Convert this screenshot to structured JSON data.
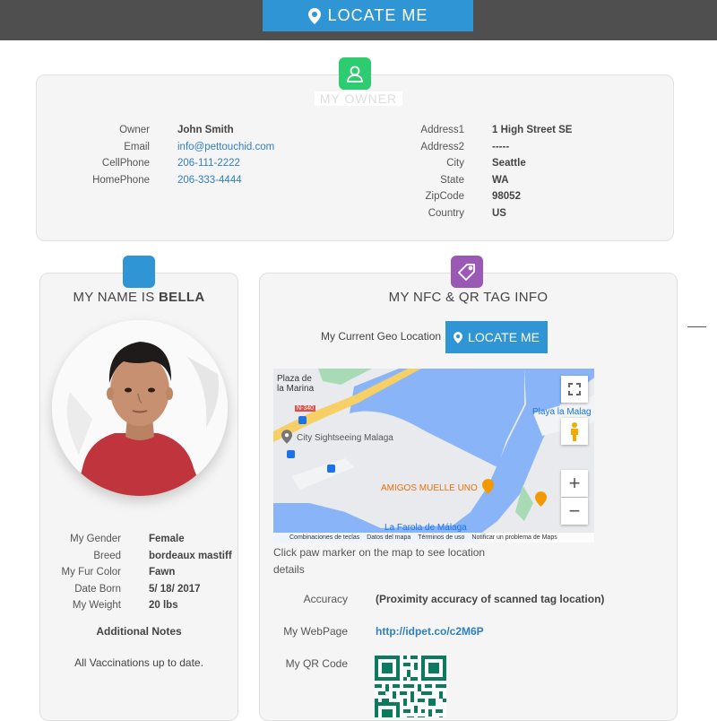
{
  "header": {
    "locate_label": "LOCATE ME"
  },
  "owner": {
    "title": "MY OWNER",
    "left_fields": [
      {
        "label": "Owner",
        "value": "John Smith"
      },
      {
        "label": "Email",
        "value": "info@pettouchid.com"
      },
      {
        "label": "CellPhone",
        "value": "206-111-2222"
      },
      {
        "label": "HomePhone",
        "value": "206-333-4444"
      }
    ],
    "right_fields": [
      {
        "label": "Address1",
        "value": "1 High Street SE"
      },
      {
        "label": "Address2",
        "value": "-----"
      },
      {
        "label": "City",
        "value": "Seattle"
      },
      {
        "label": "State",
        "value": "WA"
      },
      {
        "label": "ZipCode",
        "value": "98052"
      },
      {
        "label": "Country",
        "value": "US"
      }
    ]
  },
  "pet": {
    "title_prefix": "MY NAME IS",
    "name": "BELLA",
    "fields": [
      {
        "label": "My Gender",
        "value": "Female"
      },
      {
        "label": "Breed",
        "value": "bordeaux mastiff"
      },
      {
        "label": "My Fur Color",
        "value": "Fawn"
      },
      {
        "label": "Date Born",
        "value": "5/ 18/ 2017"
      },
      {
        "label": "My Weight",
        "value": "20 lbs"
      }
    ],
    "notes_title": "Additional Notes",
    "notes_text": "All Vaccinations up to date."
  },
  "nfc": {
    "title": "MY NFC & QR TAG INFO",
    "geo_label": "My Current Geo Location",
    "locate_label": "LOCATE ME",
    "map": {
      "labels": {
        "plaza": "Plaza de",
        "plaza2": "la Marina",
        "road": "N-340",
        "sightseeing": "City Sightseeing Malaga",
        "playa": "Playa la Malag",
        "amigos": "AMIGOS MUELLE UNO",
        "farola": "La Farola de Málaga"
      },
      "footer": [
        "Combinaciones de teclas",
        "Datos del mapa",
        "Términos de uso",
        "Notificar un problema de Maps"
      ]
    },
    "hint": "Click paw marker on the map to see location details",
    "accuracy_label": "Accuracy",
    "accuracy_value": "(Proximity accuracy of scanned tag location)",
    "webpage_label": "My WebPage",
    "webpage_value": "http://idpet.co/c2M6P",
    "qr_label": "My QR Code"
  },
  "colors": {
    "accent": "#2f95d4",
    "owner_badge": "#2ecc71",
    "tag_badge": "#9b59b6",
    "topbar": "#4f4f4f"
  }
}
